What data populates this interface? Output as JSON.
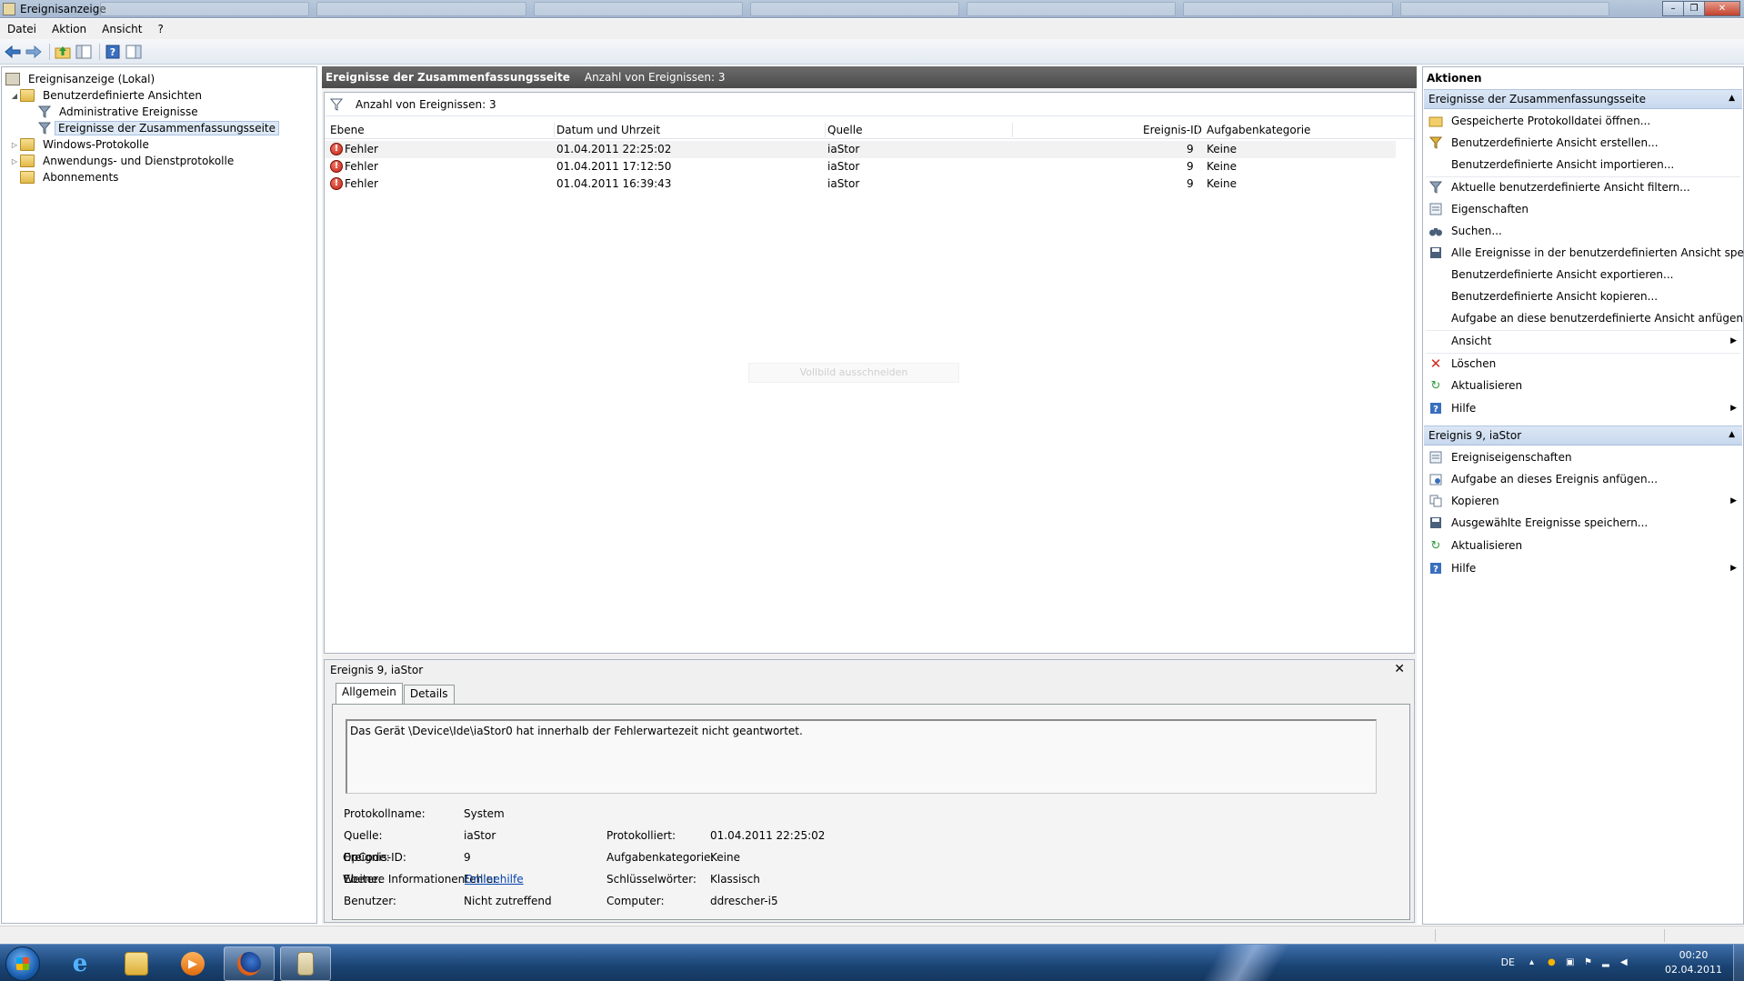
{
  "window": {
    "title": "Ereignisanzeige"
  },
  "menubar": {
    "items": [
      "Datei",
      "Aktion",
      "Ansicht",
      "?"
    ]
  },
  "toolbar": {
    "buttons": [
      "back-icon",
      "forward-icon",
      "up-folder-icon",
      "show-hide-tree-icon",
      "help-icon",
      "show-hide-action-icon"
    ]
  },
  "tree": {
    "root": "Ereignisanzeige (Lokal)",
    "custom_views": "Benutzerdefinierte Ansichten",
    "admin_events": "Administrative Ereignisse",
    "summary_events": "Ereignisse der Zusammenfassungsseite",
    "windows_logs": "Windows-Protokolle",
    "app_service_logs": "Anwendungs- und Dienstprotokolle",
    "subscriptions": "Abonnements"
  },
  "main": {
    "header_title": "Ereignisse der Zusammenfassungsseite",
    "header_count": "Anzahl von Ereignissen: 3",
    "filter_text": "Anzahl von Ereignissen: 3",
    "columns": {
      "level": "Ebene",
      "datetime": "Datum und Uhrzeit",
      "source": "Quelle",
      "event_id": "Ereignis-ID",
      "task_category": "Aufgabenkategorie"
    },
    "rows": [
      {
        "level": "Fehler",
        "datetime": "01.04.2011 22:25:02",
        "source": "iaStor",
        "event_id": "9",
        "task_category": "Keine"
      },
      {
        "level": "Fehler",
        "datetime": "01.04.2011 17:12:50",
        "source": "iaStor",
        "event_id": "9",
        "task_category": "Keine"
      },
      {
        "level": "Fehler",
        "datetime": "01.04.2011 16:39:43",
        "source": "iaStor",
        "event_id": "9",
        "task_category": "Keine"
      }
    ],
    "ghost_overlay": "Vollbild ausschneiden"
  },
  "detail": {
    "title": "Ereignis 9, iaStor",
    "tabs": [
      "Allgemein",
      "Details"
    ],
    "description": "Das Gerät \\Device\\Ide\\iaStor0 hat innerhalb der Fehlerwartezeit nicht geantwortet.",
    "fields": {
      "log_name_label": "Protokollname:",
      "log_name": "System",
      "source_label": "Quelle:",
      "source": "iaStor",
      "logged_label": "Protokolliert:",
      "logged": "01.04.2011 22:25:02",
      "event_id_label": "Ereignis-ID:",
      "event_id": "9",
      "task_category_label": "Aufgabenkategorie:",
      "task_category": "Keine",
      "level_label": "Ebene:",
      "level": "Fehler",
      "keywords_label": "Schlüsselwörter:",
      "keywords": "Klassisch",
      "user_label": "Benutzer:",
      "user": "Nicht zutreffend",
      "computer_label": "Computer:",
      "computer": "ddrescher-i5",
      "opcode_label": "OpCode:",
      "more_info_label": "Weitere Informationen:",
      "more_info_link": "Onlinehilfe"
    }
  },
  "actions": {
    "title": "Aktionen",
    "section1": "Ereignisse der Zusammenfassungsseite",
    "section1_items": [
      "Gespeicherte Protokolldatei öffnen...",
      "Benutzerdefinierte Ansicht erstellen...",
      "Benutzerdefinierte Ansicht importieren...",
      "Aktuelle benutzerdefinierte Ansicht filtern...",
      "Eigenschaften",
      "Suchen...",
      "Alle Ereignisse in der benutzerdefinierten Ansicht speic...",
      "Benutzerdefinierte Ansicht exportieren...",
      "Benutzerdefinierte Ansicht kopieren...",
      "Aufgabe an diese benutzerdefinierte Ansicht anfügen...",
      "Ansicht",
      "Löschen",
      "Aktualisieren",
      "Hilfe"
    ],
    "section2": "Ereignis 9, iaStor",
    "section2_items": [
      "Ereigniseigenschaften",
      "Aufgabe an dieses Ereignis anfügen...",
      "Kopieren",
      "Ausgewählte Ereignisse speichern...",
      "Aktualisieren",
      "Hilfe"
    ]
  },
  "taskbar": {
    "language": "DE",
    "time": "00:20",
    "date": "02.04.2011"
  },
  "colors": {
    "header_bg": "#555555",
    "action_section_bg": "#c7d8ee",
    "error_red": "#c01f10",
    "taskbar_blue": "#1a4373"
  }
}
